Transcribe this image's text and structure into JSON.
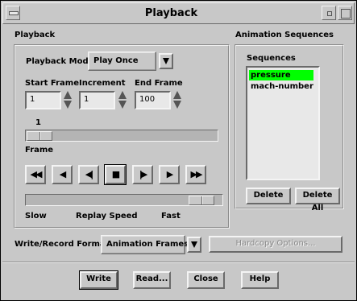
{
  "window": {
    "title": "Playback"
  },
  "playback": {
    "group_label": "Playback",
    "mode_label": "Playback Mode",
    "mode_value": "Play Once",
    "start_frame_label": "Start Frame",
    "start_frame_value": "1",
    "increment_label": "Increment",
    "increment_value": "1",
    "end_frame_label": "End Frame",
    "end_frame_value": "100",
    "current_frame": "1",
    "frame_label": "Frame",
    "frame_position": 0.0,
    "controls": [
      {
        "name": "fast-rewind",
        "glyph": "◀◀"
      },
      {
        "name": "step-back",
        "glyph": "◀"
      },
      {
        "name": "step-back-frame",
        "glyph": "◀|"
      },
      {
        "name": "stop",
        "glyph": "■"
      },
      {
        "name": "step-forward-frame",
        "glyph": "|▶"
      },
      {
        "name": "play",
        "glyph": "▶"
      },
      {
        "name": "fast-forward",
        "glyph": "▶▶"
      }
    ],
    "speed_slow_label": "Slow",
    "speed_label": "Replay Speed",
    "speed_fast_label": "Fast",
    "speed_position": 0.95
  },
  "sequences": {
    "group_label": "Animation Sequences",
    "list_label": "Sequences",
    "items": [
      "pressure",
      "mach-number"
    ],
    "selected": "pressure",
    "delete_label": "Delete",
    "delete_all_label": "Delete All"
  },
  "record": {
    "format_label": "Write/Record Format",
    "format_value": "Animation Frames",
    "hardcopy_label": "Hardcopy Options..."
  },
  "buttons": {
    "write": "Write",
    "read": "Read...",
    "close": "Close",
    "help": "Help"
  },
  "colors": {
    "selection": "#00ff00",
    "background": "#c8c8c8"
  }
}
